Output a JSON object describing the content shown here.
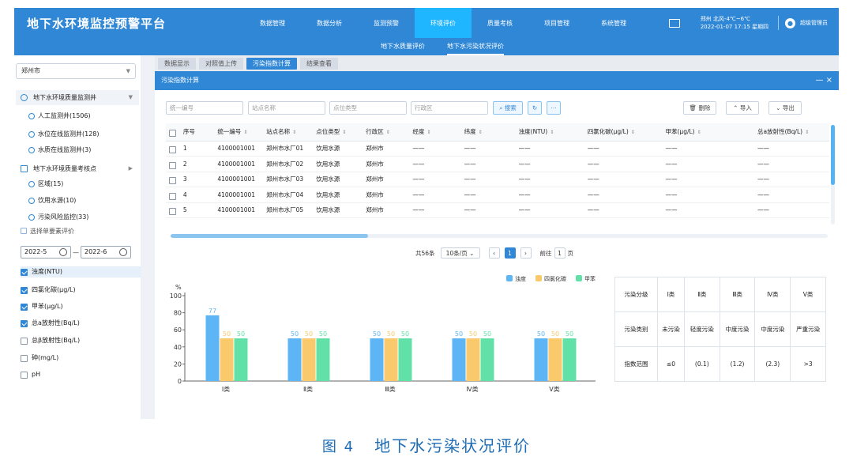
{
  "app": {
    "title": "地下水环境监控预警平台"
  },
  "nav": {
    "items": [
      "数据管理",
      "数据分析",
      "监测预警",
      "环境评价",
      "质量考核",
      "项目管理",
      "系统管理"
    ],
    "active_index": 3
  },
  "topright": {
    "weather_line1": "郑州 北风-4℃~6℃",
    "weather_line2": "2022-01-07 17:15 星期四",
    "user": "超级管理员"
  },
  "subnav": {
    "items": [
      "地下水质量评价",
      "地下水污染状况评价"
    ],
    "active_index": 1
  },
  "sidebar": {
    "city": "郑州市",
    "group1": {
      "title": "地下水环境质量监测井",
      "items": [
        "人工监测井(1506)",
        "水位在线监测井(128)",
        "水质在线监测井(3)"
      ]
    },
    "group2": {
      "title": "地下水环境质量考核点",
      "items": [
        "区域(15)",
        "饮用水源(10)",
        "污染风险监控(33)"
      ]
    },
    "eval_title": "选择单要素评价",
    "date_start": "2022-5",
    "date_end": "2022-6",
    "checks": [
      {
        "label": "浊度(NTU)",
        "checked": true
      },
      {
        "label": "四氯化碳(μg/L)",
        "checked": true
      },
      {
        "label": "甲苯(μg/L)",
        "checked": true
      },
      {
        "label": "总a放射性(Bq/L)",
        "checked": true
      },
      {
        "label": "总β放射性(Bq/L)",
        "checked": false
      },
      {
        "label": "砷(mg/L)",
        "checked": false
      },
      {
        "label": "pH",
        "checked": false
      }
    ]
  },
  "tabs": {
    "items": [
      "数据显示",
      "对照值上传",
      "污染指数计算",
      "结果查看"
    ],
    "active_index": 2
  },
  "panel": {
    "title": "污染指数计算",
    "controls": "— ×"
  },
  "filters": {
    "code_ph": "统一编号",
    "station_ph": "站点名称",
    "type_ph": "点位类型",
    "region_ph": "行政区",
    "search": "搜索",
    "delete": "删除",
    "import": "导入",
    "export": "导出"
  },
  "table": {
    "headers": [
      "序号",
      "统一编号",
      "站点名称",
      "点位类型",
      "行政区",
      "经度",
      "纬度",
      "浊度(NTU)",
      "四氯化碳(μg/L)",
      "甲苯(μg/L)",
      "总a放射性(Bq/L)"
    ],
    "rows": [
      [
        "1",
        "4100001001",
        "郑州市水厂01",
        "饮用水源",
        "郑州市",
        "——",
        "——",
        "——",
        "——",
        "——",
        "——"
      ],
      [
        "2",
        "4100001001",
        "郑州市水厂02",
        "饮用水源",
        "郑州市",
        "——",
        "——",
        "——",
        "——",
        "——",
        "——"
      ],
      [
        "3",
        "4100001001",
        "郑州市水厂03",
        "饮用水源",
        "郑州市",
        "——",
        "——",
        "——",
        "——",
        "——",
        "——"
      ],
      [
        "4",
        "4100001001",
        "郑州市水厂04",
        "饮用水源",
        "郑州市",
        "——",
        "——",
        "——",
        "——",
        "——",
        "——"
      ],
      [
        "5",
        "4100001001",
        "郑州市水厂05",
        "饮用水源",
        "郑州市",
        "——",
        "——",
        "——",
        "——",
        "——",
        "——"
      ]
    ]
  },
  "pager": {
    "total": "共56条",
    "page_size": "10条/页",
    "current": "1",
    "goto_label": "前往",
    "goto_value": "1",
    "page_unit": "页"
  },
  "chart_data": {
    "type": "bar",
    "ylabel": "%",
    "ylim": [
      0,
      100
    ],
    "yticks": [
      0,
      20,
      40,
      60,
      80,
      100
    ],
    "categories": [
      "Ⅰ类",
      "Ⅱ类",
      "Ⅲ类",
      "Ⅳ类",
      "Ⅴ类"
    ],
    "series": [
      {
        "name": "浊度",
        "color": "#5db5f5",
        "values": [
          77,
          50,
          50,
          50,
          50
        ]
      },
      {
        "name": "四氯化碳",
        "color": "#f9c96b",
        "values": [
          50,
          50,
          50,
          50,
          50
        ]
      },
      {
        "name": "甲苯",
        "color": "#61e0a8",
        "values": [
          50,
          50,
          50,
          50,
          50
        ]
      }
    ],
    "grid": false,
    "legend": "top-right"
  },
  "level_table": {
    "rows": [
      [
        "污染分级",
        "Ⅰ类",
        "Ⅱ类",
        "Ⅲ类",
        "Ⅳ类",
        "Ⅴ类"
      ],
      [
        "污染类别",
        "未污染",
        "轻度污染",
        "中度污染",
        "中度污染",
        "严重污染"
      ],
      [
        "指数范围",
        "≤0",
        "(0.1)",
        "(1.2)",
        "(2.3)",
        ">3"
      ]
    ]
  },
  "caption": {
    "num": "图 4",
    "text": "地下水污染状况评价"
  }
}
